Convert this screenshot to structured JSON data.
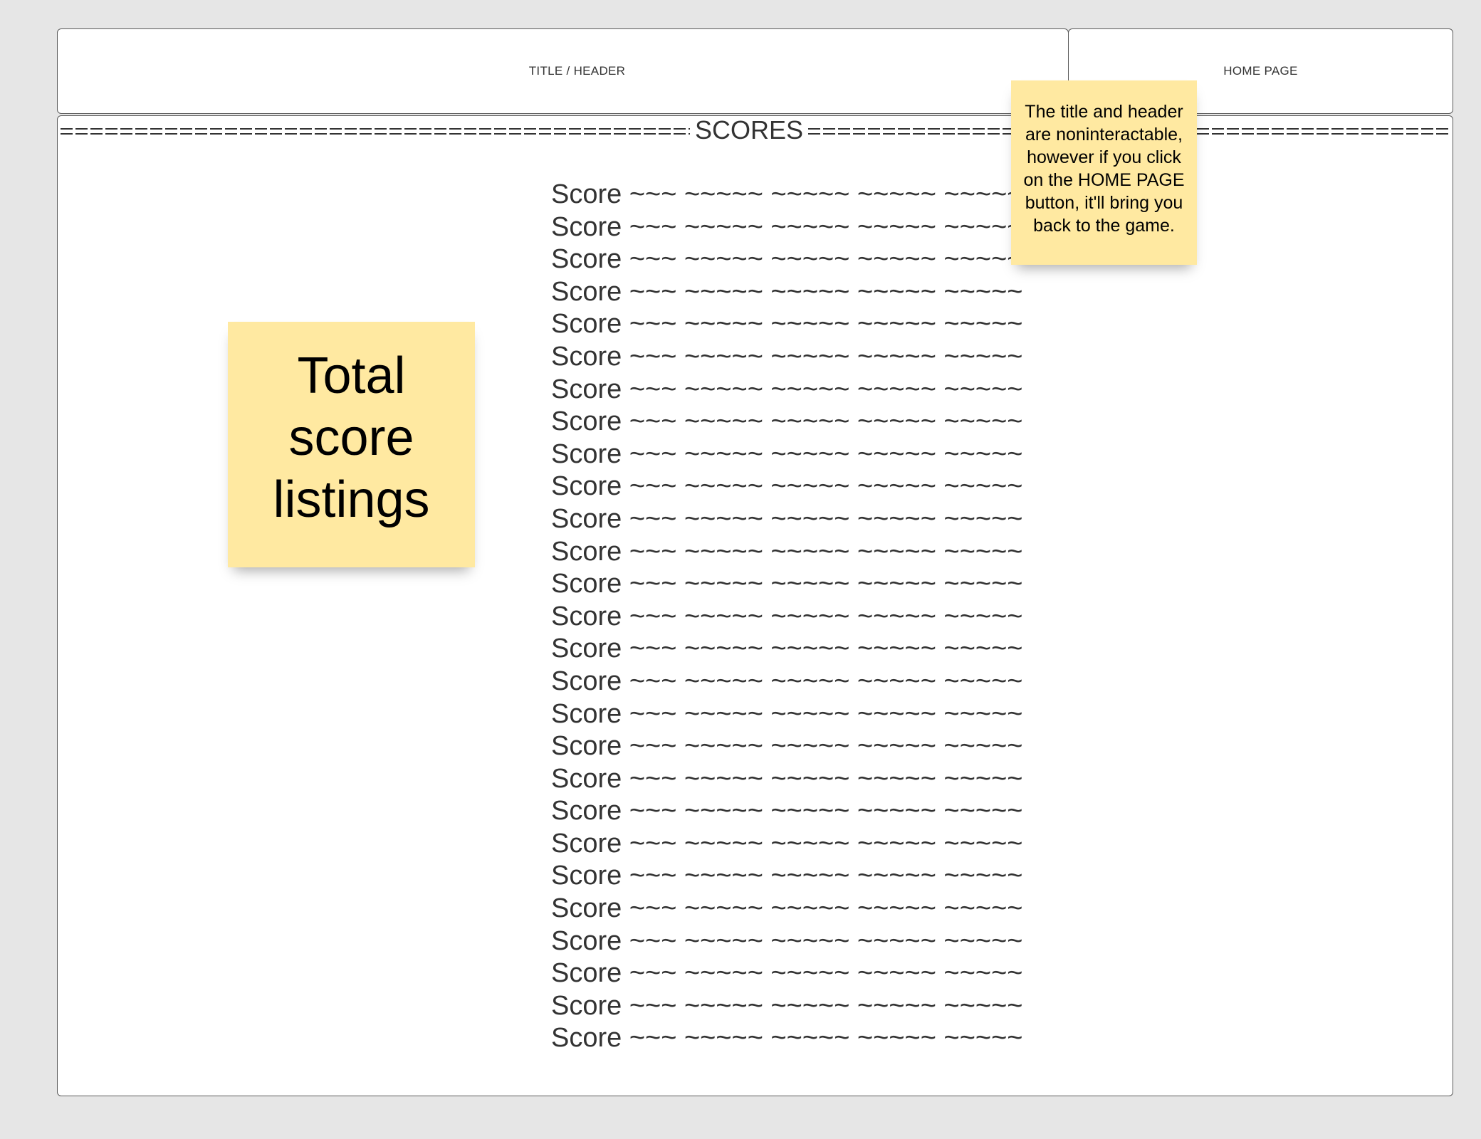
{
  "header": {
    "title": "TITLE / HEADER",
    "home_button_label": "HOME PAGE"
  },
  "main": {
    "banner_title": "SCORES",
    "score_rows": [
      "Score ~~~ ~~~~~ ~~~~~ ~~~~~ ~~~~~",
      "Score ~~~ ~~~~~ ~~~~~ ~~~~~ ~~~~~",
      "Score ~~~ ~~~~~ ~~~~~ ~~~~~ ~~~~~",
      "Score ~~~ ~~~~~ ~~~~~ ~~~~~ ~~~~~",
      "Score ~~~ ~~~~~ ~~~~~ ~~~~~ ~~~~~",
      "Score ~~~ ~~~~~ ~~~~~ ~~~~~ ~~~~~",
      "Score ~~~ ~~~~~ ~~~~~ ~~~~~ ~~~~~",
      "Score ~~~ ~~~~~ ~~~~~ ~~~~~ ~~~~~",
      "Score ~~~ ~~~~~ ~~~~~ ~~~~~ ~~~~~",
      "Score ~~~ ~~~~~ ~~~~~ ~~~~~ ~~~~~",
      "Score ~~~ ~~~~~ ~~~~~ ~~~~~ ~~~~~",
      "Score ~~~ ~~~~~ ~~~~~ ~~~~~ ~~~~~",
      "Score ~~~ ~~~~~ ~~~~~ ~~~~~ ~~~~~",
      "Score ~~~ ~~~~~ ~~~~~ ~~~~~ ~~~~~",
      "Score ~~~ ~~~~~ ~~~~~ ~~~~~ ~~~~~",
      "Score ~~~ ~~~~~ ~~~~~ ~~~~~ ~~~~~",
      "Score ~~~ ~~~~~ ~~~~~ ~~~~~ ~~~~~",
      "Score ~~~ ~~~~~ ~~~~~ ~~~~~ ~~~~~",
      "Score ~~~ ~~~~~ ~~~~~ ~~~~~ ~~~~~",
      "Score ~~~ ~~~~~ ~~~~~ ~~~~~ ~~~~~",
      "Score ~~~ ~~~~~ ~~~~~ ~~~~~ ~~~~~",
      "Score ~~~ ~~~~~ ~~~~~ ~~~~~ ~~~~~",
      "Score ~~~ ~~~~~ ~~~~~ ~~~~~ ~~~~~",
      "Score ~~~ ~~~~~ ~~~~~ ~~~~~ ~~~~~",
      "Score ~~~ ~~~~~ ~~~~~ ~~~~~ ~~~~~",
      "Score ~~~ ~~~~~ ~~~~~ ~~~~~ ~~~~~",
      "Score ~~~ ~~~~~ ~~~~~ ~~~~~ ~~~~~"
    ]
  },
  "notes": {
    "total_listing": "Total score listings",
    "header_info": "The title and header are noninteractable, however if you click on the HOME PAGE button, it'll bring you back to the game."
  },
  "colors": {
    "background": "#e6e6e6",
    "panel": "#ffffff",
    "border": "#5a5a5a",
    "text": "#333333",
    "sticky_note": "#ffe9a1"
  }
}
